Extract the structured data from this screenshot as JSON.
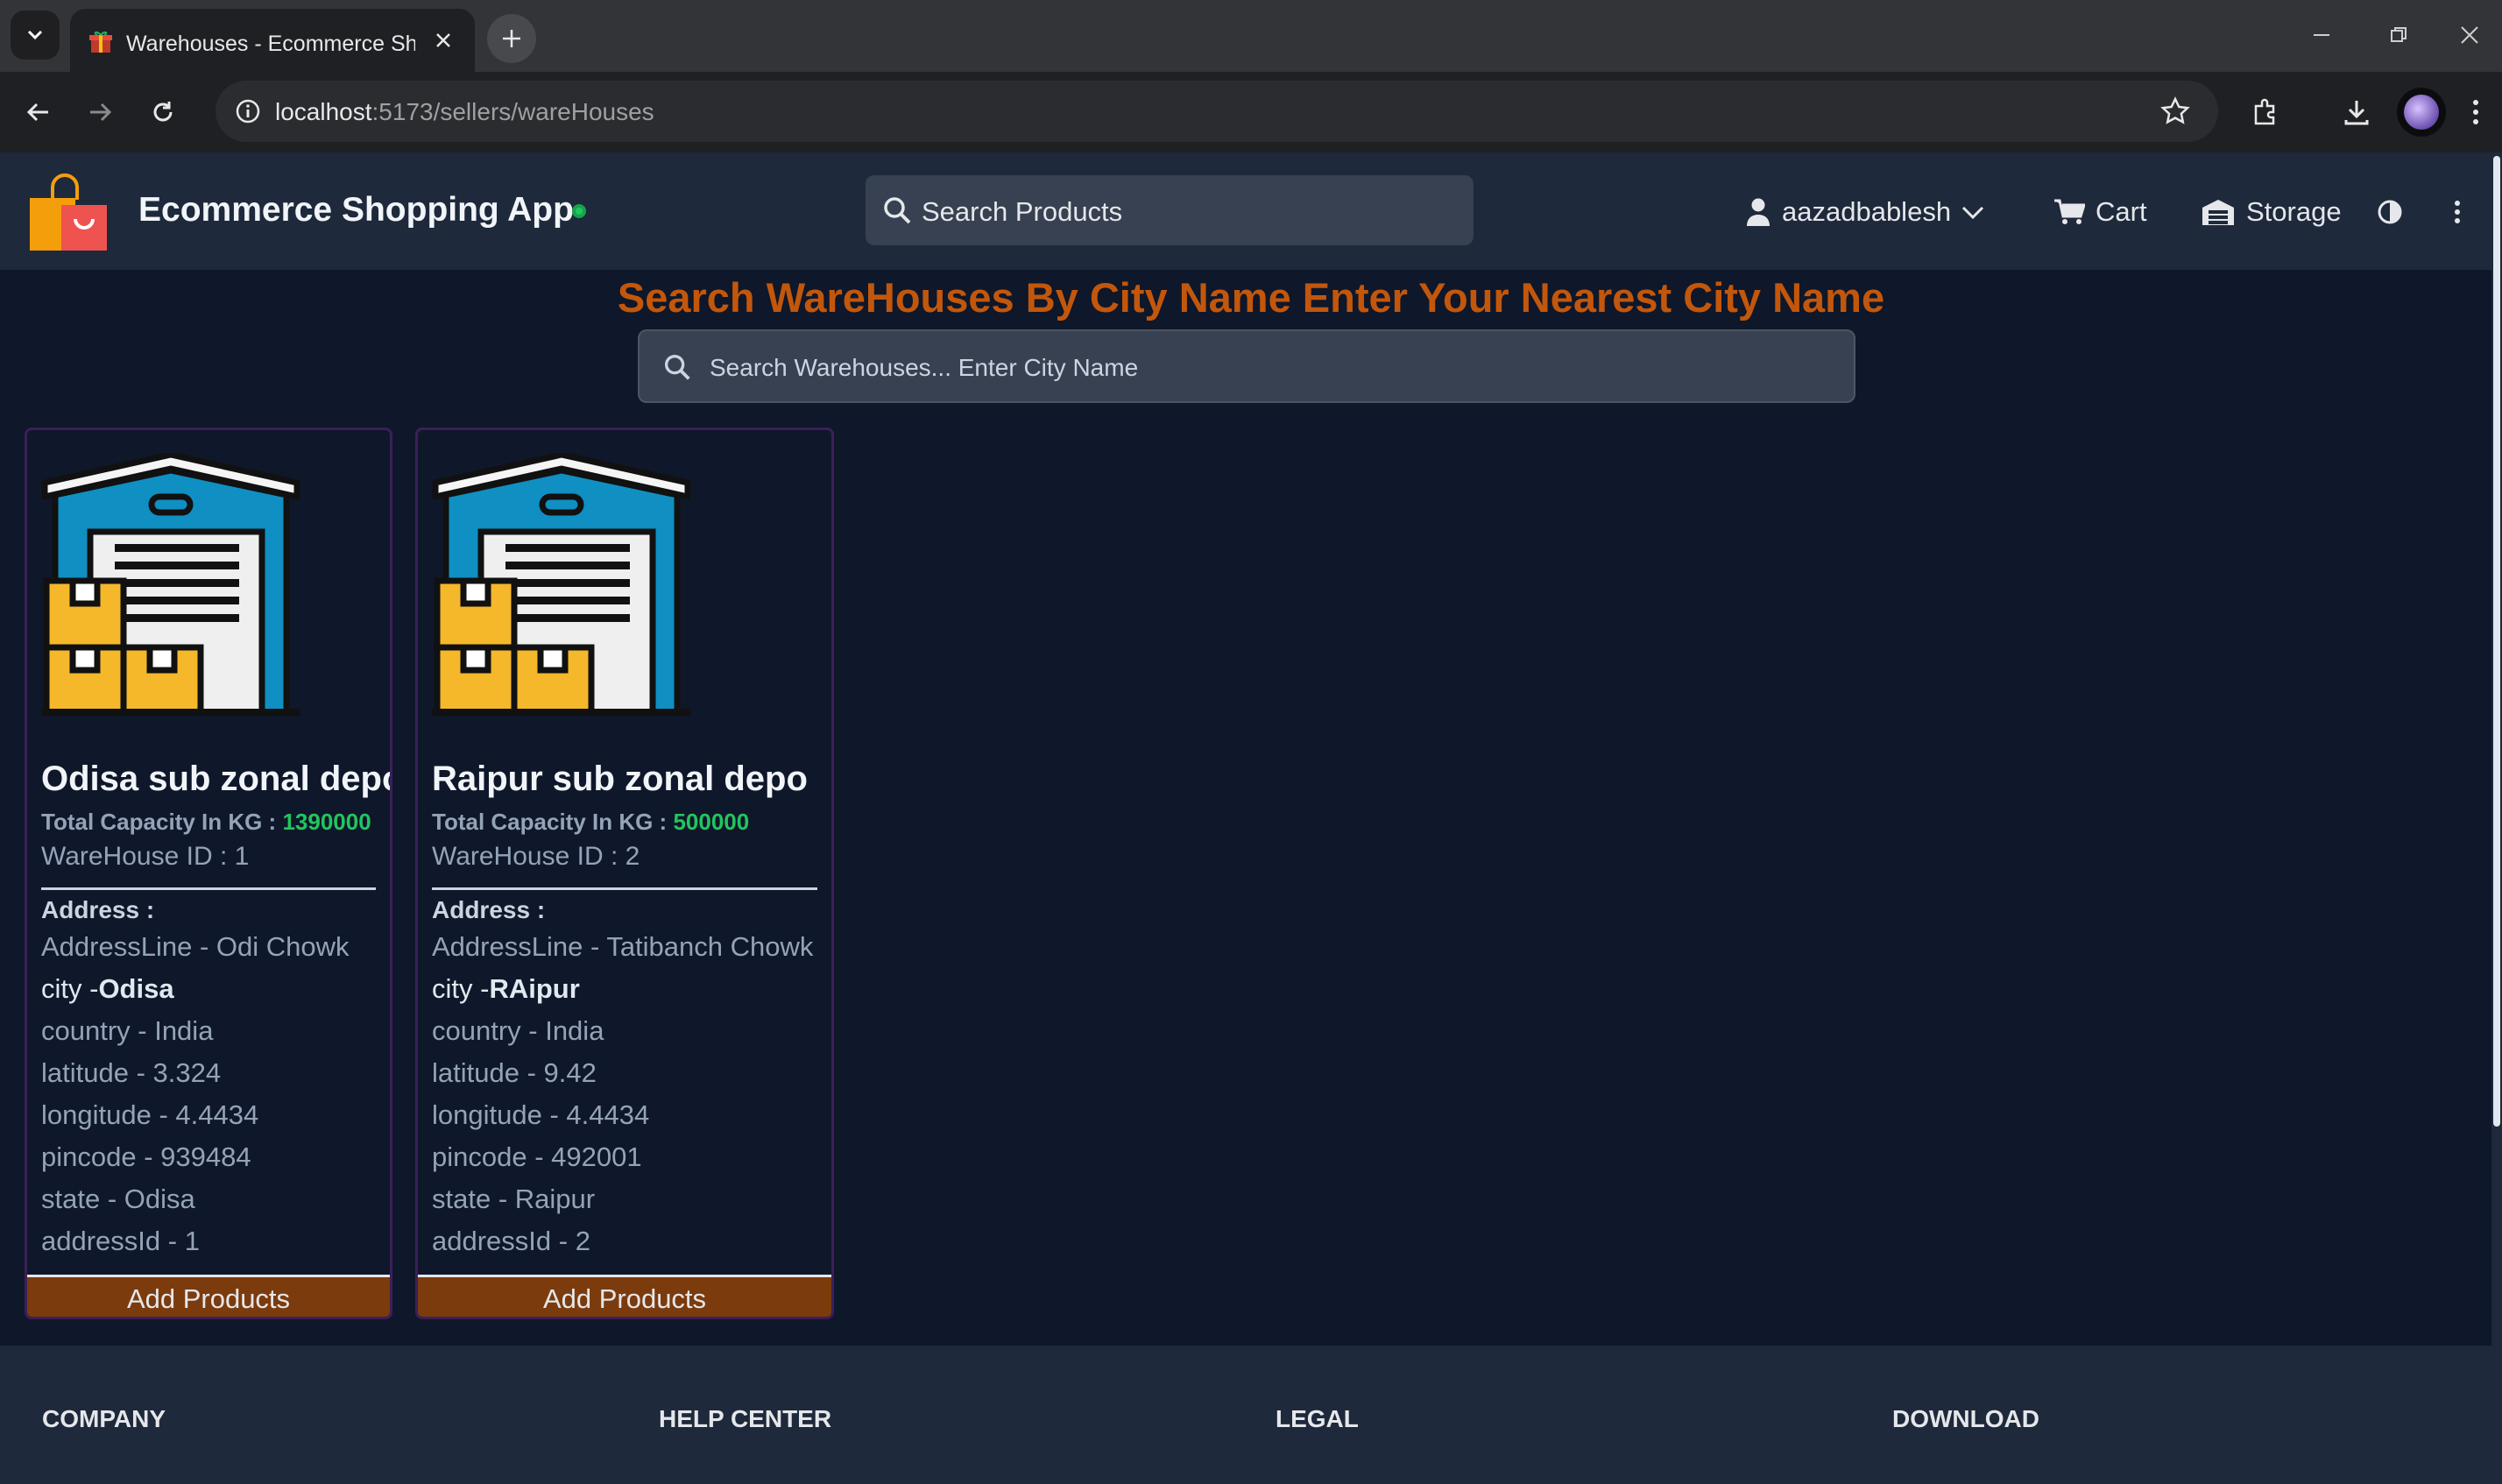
{
  "browser": {
    "tab_title": "Warehouses - Ecommerce Shop",
    "url_host": "localhost",
    "url_path": ":5173/sellers/wareHouses"
  },
  "header": {
    "brand": "Ecommerce Shopping App",
    "search_placeholder": "Search Products",
    "username": "aazadbablesh",
    "cart_label": "Cart",
    "storage_label": "Storage"
  },
  "main": {
    "heading": "Search WareHouses By City Name Enter Your Nearest City Name",
    "search_placeholder": "Search Warehouses... Enter City Name"
  },
  "warehouses": [
    {
      "name": "Odisa sub zonal depo",
      "capacity_label": "Total Capacity In KG : ",
      "capacity": "1390000",
      "id_text": "WareHouse ID : 1",
      "address_label": "Address :",
      "address_line": "AddressLine - Odi Chowk",
      "city_prefix": "city -",
      "city": "Odisa",
      "country": "country - India",
      "latitude": "latitude - 3.324",
      "longitude": "longitude - 4.4434",
      "pincode": "pincode - 939484",
      "state": "state - Odisa",
      "address_id": "addressId - 1",
      "button": "Add Products"
    },
    {
      "name": "Raipur sub zonal depo",
      "capacity_label": "Total Capacity In KG : ",
      "capacity": "500000",
      "id_text": "WareHouse ID : 2",
      "address_label": "Address :",
      "address_line": "AddressLine - Tatibanch Chowk",
      "city_prefix": "city -",
      "city": "RAipur",
      "country": "country - India",
      "latitude": "latitude - 9.42",
      "longitude": "longitude - 4.4434",
      "pincode": "pincode - 492001",
      "state": "state - Raipur",
      "address_id": "addressId - 2",
      "button": "Add Products"
    }
  ],
  "footer": {
    "headings": [
      "COMPANY",
      "HELP CENTER",
      "LEGAL",
      "DOWNLOAD"
    ]
  },
  "colors": {
    "page_bg": "#0f172a",
    "header_bg": "#1e293b",
    "heading_orange": "#c2570c",
    "button_brown": "#7c3b0d",
    "capacity_green": "#22c55e"
  }
}
